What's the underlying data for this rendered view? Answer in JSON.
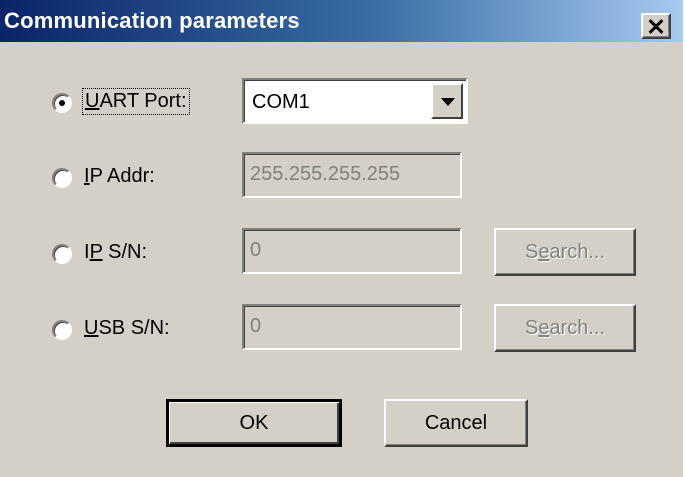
{
  "window": {
    "title": "Communication parameters"
  },
  "options": {
    "uart": {
      "label_u": "U",
      "label_rest": "ART Port:",
      "selected": true,
      "value": "COM1"
    },
    "ip_addr": {
      "label_u": "I",
      "label_rest": "P Addr:",
      "selected": false,
      "value": "255.255.255.255"
    },
    "ip_sn": {
      "label_pre": "I",
      "label_u": "P",
      "label_rest": " S/N:",
      "selected": false,
      "value": "0",
      "search_pre": "S",
      "search_u": "e",
      "search_rest": "arch..."
    },
    "usb_sn": {
      "label_u": "U",
      "label_rest": "SB S/N:",
      "selected": false,
      "value": "0",
      "search_pre": "S",
      "search_u": "e",
      "search_rest": "arch..."
    }
  },
  "buttons": {
    "ok": "OK",
    "cancel": "Cancel"
  }
}
